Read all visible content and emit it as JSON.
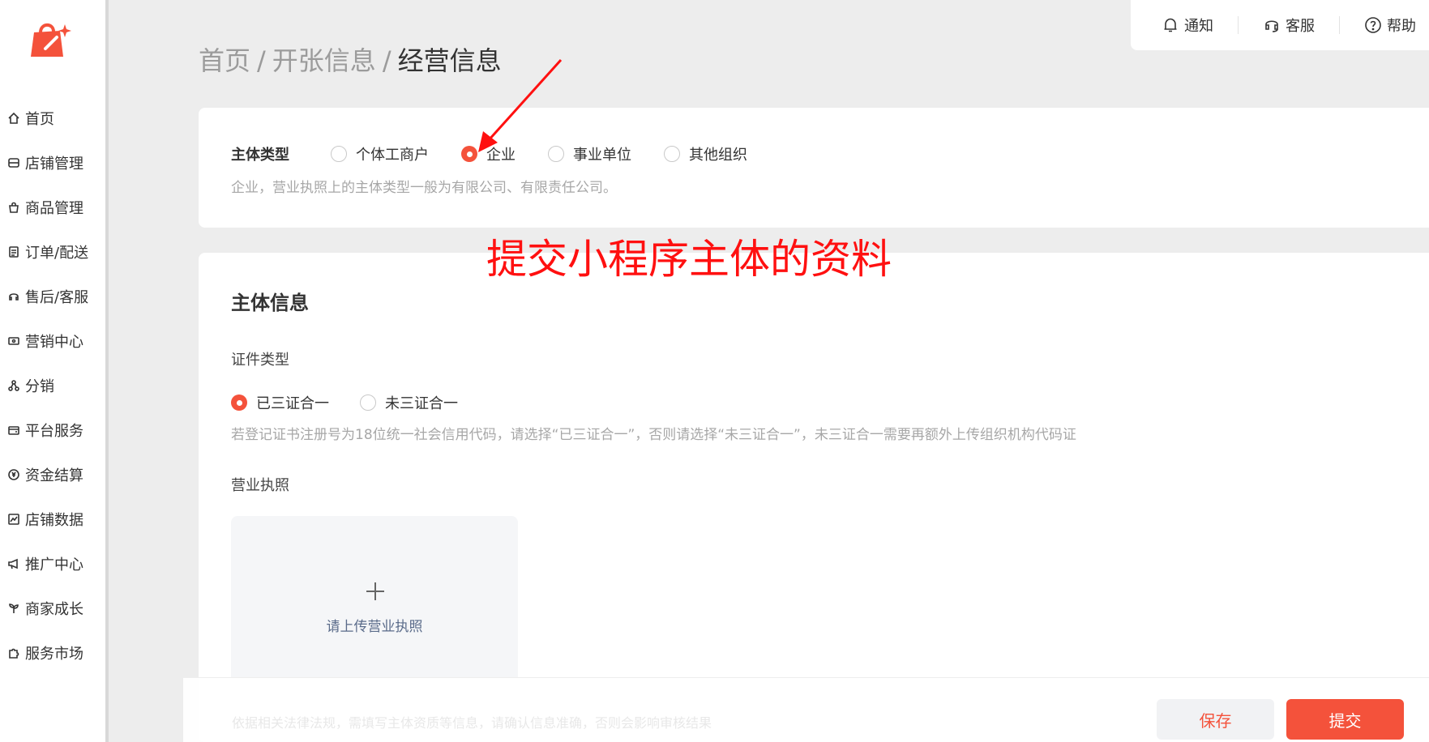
{
  "breadcrumb": {
    "item1": "首页",
    "item2": "开张信息",
    "current": "经营信息",
    "separator": "/"
  },
  "toolbar": {
    "notify": "通知",
    "service": "客服",
    "help": "帮助"
  },
  "sidebar": {
    "items": [
      {
        "label": "首页",
        "icon": "home-icon"
      },
      {
        "label": "店铺管理",
        "icon": "store-icon"
      },
      {
        "label": "商品管理",
        "icon": "bag-icon"
      },
      {
        "label": "订单/配送",
        "icon": "order-icon"
      },
      {
        "label": "售后/客服",
        "icon": "headset-icon"
      },
      {
        "label": "营销中心",
        "icon": "ticket-icon"
      },
      {
        "label": "分销",
        "icon": "share-icon"
      },
      {
        "label": "平台服务",
        "icon": "wallet-icon"
      },
      {
        "label": "资金结算",
        "icon": "yen-icon"
      },
      {
        "label": "店铺数据",
        "icon": "chart-icon"
      },
      {
        "label": "推广中心",
        "icon": "megaphone-icon"
      },
      {
        "label": "商家成长",
        "icon": "sprout-icon"
      },
      {
        "label": "服务市场",
        "icon": "puzzle-icon"
      }
    ]
  },
  "entity_type": {
    "label": "主体类型",
    "options": [
      "个体工商户",
      "企业",
      "事业单位",
      "其他组织"
    ],
    "selected": "企业",
    "hint": "企业，营业执照上的主体类型一般为有限公司、有限责任公司。"
  },
  "annotation": {
    "text": "提交小程序主体的资料",
    "color": "#ff1010"
  },
  "entity_info": {
    "title": "主体信息",
    "cert_type_label": "证件类型",
    "cert_options": [
      "已三证合一",
      "未三证合一"
    ],
    "cert_selected": "已三证合一",
    "cert_hint": "若登记证书注册号为18位统一社会信用代码，请选择“已三证合一”，否则请选择“未三证合一”，未三证合一需要再额外上传组织机构代码证",
    "license_label": "营业执照",
    "upload_text": "请上传营业执照"
  },
  "actions": {
    "faded_note": "依据相关法律法规，需填写主体资质等信息，请确认信息准确，否则会影响审核结果",
    "save": "保存",
    "submit": "提交"
  },
  "colors": {
    "accent": "#f4523b",
    "annotation": "#ff1010"
  }
}
